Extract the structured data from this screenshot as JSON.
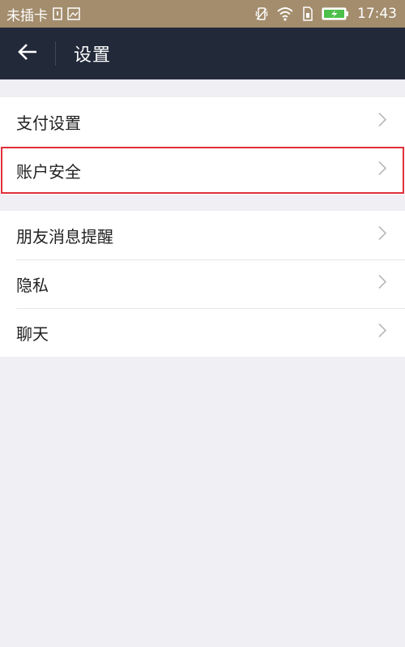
{
  "status_bar": {
    "carrier": "未插卡",
    "time": "17:43",
    "icons": [
      "sim-icon",
      "image-icon",
      "vibrate-icon",
      "wifi-icon",
      "sim-card-icon",
      "battery-charging-icon"
    ]
  },
  "header": {
    "title": "设置",
    "back_icon": "back-arrow-icon"
  },
  "groups": [
    {
      "items": [
        {
          "label": "支付设置"
        },
        {
          "label": "账户安全",
          "highlighted": true
        }
      ]
    },
    {
      "items": [
        {
          "label": "朋友消息提醒"
        },
        {
          "label": "隐私"
        },
        {
          "label": "聊天"
        }
      ]
    }
  ],
  "colors": {
    "status_bar": "#a38d6d",
    "header": "#222a3a",
    "background": "#efeff4",
    "highlight": "#e0303a"
  }
}
